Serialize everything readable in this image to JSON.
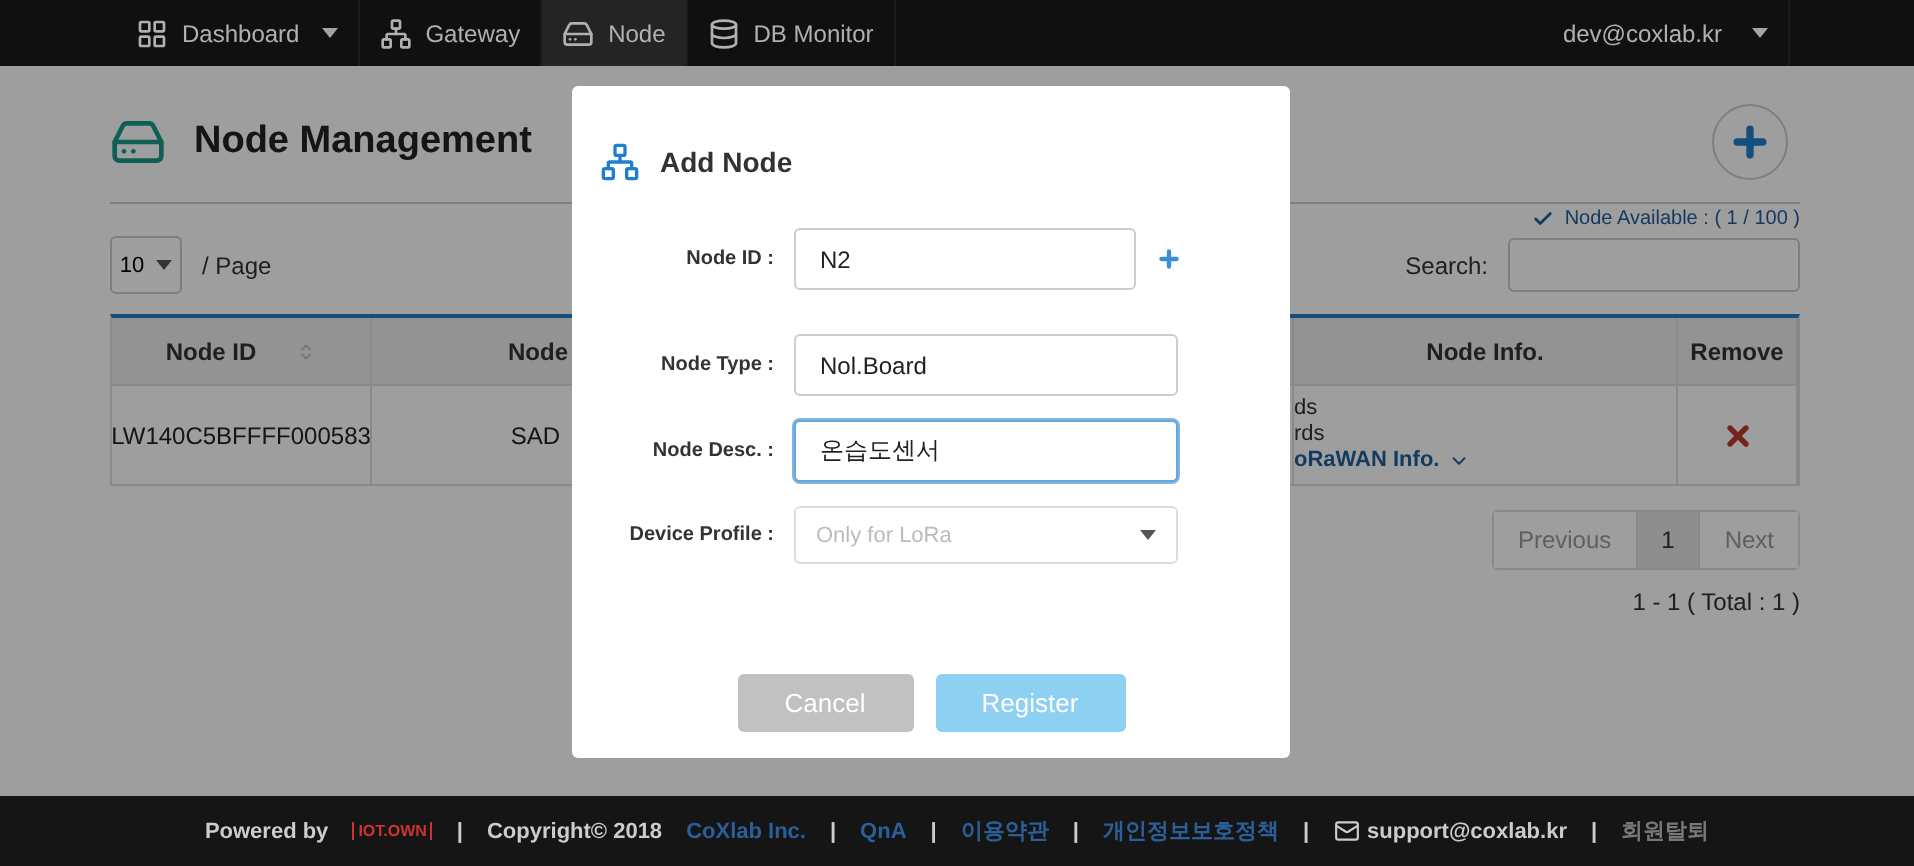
{
  "nav": {
    "items": [
      {
        "label": "Dashboard",
        "kind": "grid",
        "dropdown": true,
        "selected": false
      },
      {
        "label": "Gateway",
        "kind": "tree",
        "dropdown": false,
        "selected": false
      },
      {
        "label": "Node",
        "kind": "drive",
        "dropdown": false,
        "selected": true
      },
      {
        "label": "DB Monitor",
        "kind": "database",
        "dropdown": false,
        "selected": false
      }
    ],
    "user": "dev@coxlab.kr"
  },
  "page": {
    "title": "Node Management",
    "availability": "Node Available : ( 1 / 100 )",
    "page_size": "10",
    "page_size_label": "/ Page",
    "search_label": "Search:",
    "table": {
      "columns": [
        {
          "label": "Node ID",
          "sortable": true
        },
        {
          "label": "Node",
          "sortable": false
        },
        {
          "label": "Node Info.",
          "sortable": false
        },
        {
          "label": "Remove",
          "sortable": false
        }
      ],
      "rows": [
        {
          "node_id": "LW140C5BFFFF000583",
          "column_2": "SAD",
          "node_info": [
            "ds",
            "rds"
          ],
          "node_info_link": "oRaWAN Info."
        }
      ]
    },
    "pagination": {
      "previous": "Previous",
      "pages": [
        {
          "label": "1",
          "selected": true
        }
      ],
      "next": "Next"
    },
    "summary": "1 - 1 ( Total : 1 )"
  },
  "modal": {
    "title": "Add Node",
    "fields": [
      {
        "kind": "input",
        "label": "Node ID :",
        "value": "N2",
        "focused": false,
        "add": true
      },
      {
        "kind": "input",
        "label": "Node Type :",
        "value": "Nol.Board",
        "focused": false,
        "add": false
      },
      {
        "kind": "input",
        "label": "Node Desc. :",
        "value": "온습도센서",
        "focused": true,
        "add": false
      },
      {
        "kind": "select",
        "label": "Device Profile :",
        "placeholder": "Only for LoRa",
        "focused": false,
        "add": false
      }
    ],
    "buttons": [
      {
        "label": "Cancel",
        "kind": "cancel"
      },
      {
        "label": "Register",
        "kind": "primary"
      }
    ]
  },
  "footer": {
    "separator": "|",
    "powered_by": "Powered by",
    "logo": "IOT.OWN",
    "copyright": "Copyright© 2018",
    "company": "CoXlab Inc.",
    "links": [
      "QnA",
      "이용약관",
      "개인정보보호정책"
    ],
    "email": "support@coxlab.kr",
    "withdraw": "회원탈퇴"
  }
}
